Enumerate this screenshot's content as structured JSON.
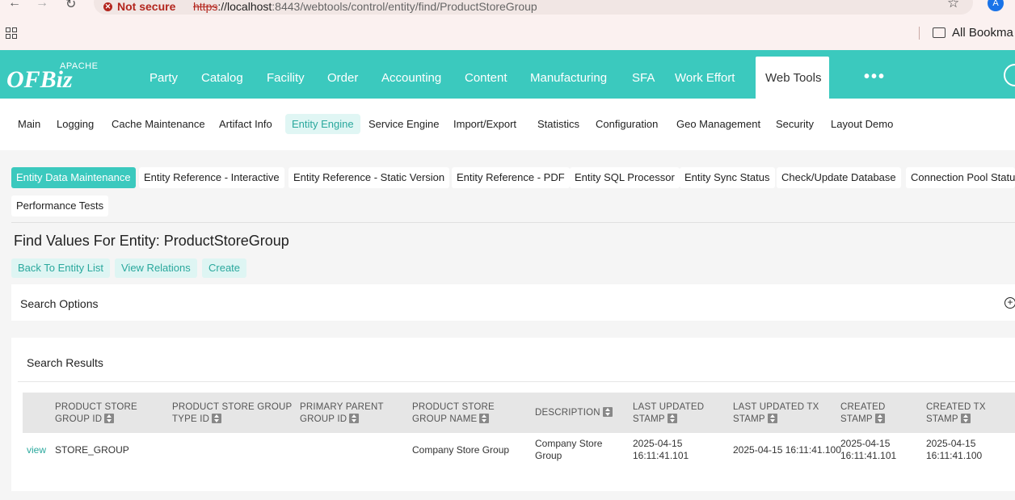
{
  "browser": {
    "security_label": "Not secure",
    "url_scheme": "https",
    "url_host": "://localhost",
    "url_rest": ":8443/webtools/control/entity/find/ProductStoreGroup",
    "profile_initial": "A",
    "bookmarks_label": "All Bookma"
  },
  "logo": {
    "apache": "APACHE",
    "name": "OFBiz"
  },
  "main_menu": [
    "Party",
    "Catalog",
    "Facility",
    "Order",
    "Accounting",
    "Content",
    "Manufacturing",
    "SFA",
    "Work Effort",
    "Web Tools"
  ],
  "more_label": "•••",
  "sub_menu": [
    "Main",
    "Logging",
    "Cache Maintenance",
    "Artifact Info",
    "Entity Engine",
    "Service Engine",
    "Import/Export",
    "Statistics",
    "Configuration",
    "Geo Management",
    "Security",
    "Layout Demo"
  ],
  "tabs": [
    "Entity Data Maintenance",
    "Entity Reference - Interactive",
    "Entity Reference - Static Version",
    "Entity Reference - PDF",
    "Entity SQL Processor",
    "Entity Sync Status",
    "Check/Update Database",
    "Connection Pool Status",
    "Performance Tests"
  ],
  "page_title": "Find Values For Entity: ProductStoreGroup",
  "actions": [
    "Back To Entity List",
    "View Relations",
    "Create"
  ],
  "search_options_label": "Search Options",
  "search_results_label": "Search Results",
  "table": {
    "headers": [
      [
        "PRODUCT STORE",
        "GROUP ID"
      ],
      [
        "PRODUCT STORE GROUP",
        "TYPE ID"
      ],
      [
        "PRIMARY PARENT",
        "GROUP ID"
      ],
      [
        "PRODUCT STORE",
        "GROUP NAME"
      ],
      [
        "DESCRIPTION",
        ""
      ],
      [
        "LAST UPDATED",
        "STAMP"
      ],
      [
        "LAST UPDATED TX",
        "STAMP"
      ],
      [
        "CREATED",
        "STAMP"
      ],
      [
        "CREATED TX",
        "STAMP"
      ]
    ],
    "row": {
      "view": "view",
      "cells": [
        [
          "STORE_GROUP",
          ""
        ],
        [
          "",
          ""
        ],
        [
          "",
          ""
        ],
        [
          "Company Store Group",
          ""
        ],
        [
          "Company Store",
          "Group"
        ],
        [
          "2025-04-15",
          "16:11:41.101"
        ],
        [
          "2025-04-15 16:11:41.100",
          ""
        ],
        [
          "2025-04-15",
          "16:11:41.101"
        ],
        [
          "2025-04-15",
          "16:11:41.100"
        ]
      ]
    }
  }
}
